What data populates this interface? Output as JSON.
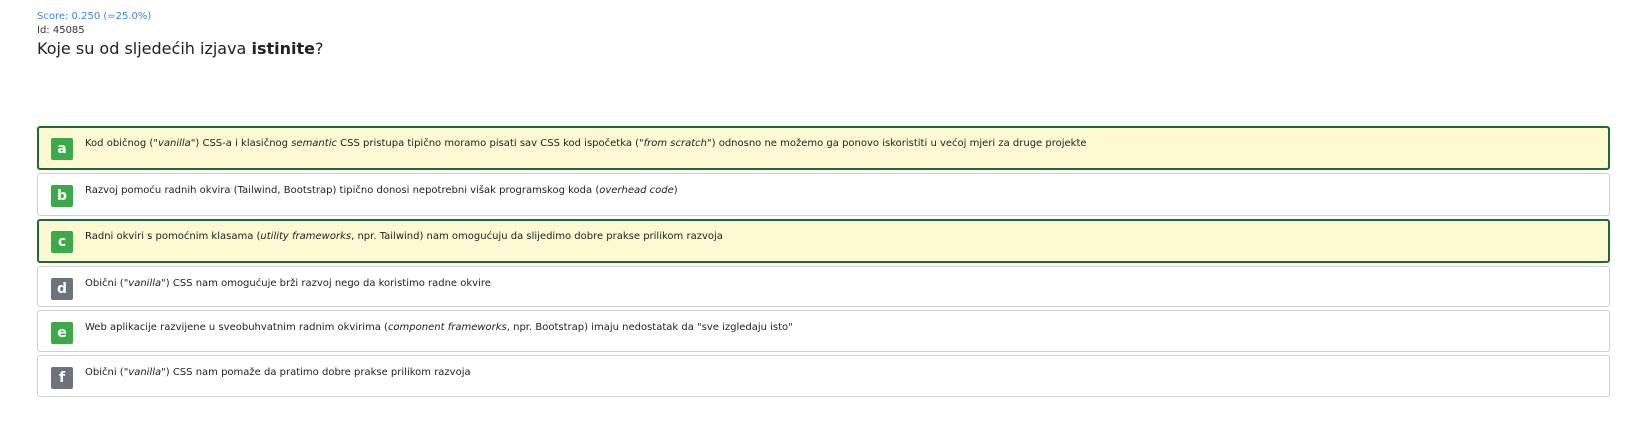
{
  "header": {
    "score": "Score: 0.250 (=25.0%)",
    "id": "Id: 45085",
    "question_pre": "Koje su od sljedećih izjava ",
    "question_bold": "istinite",
    "question_post": "?"
  },
  "options": [
    {
      "letter": "a",
      "selected": true,
      "badge_color": "green",
      "segments": [
        {
          "t": "Kod običnog (\""
        },
        {
          "t": "vanilla",
          "i": true
        },
        {
          "t": "\") CSS-a i klasičnog "
        },
        {
          "t": "semantic",
          "i": true
        },
        {
          "t": " CSS pristupa tipično moramo pisati sav CSS kod ispočetka (\""
        },
        {
          "t": "from scratch",
          "i": true
        },
        {
          "t": "\") odnosno ne možemo ga ponovo iskoristiti u većoj mjeri za druge projekte"
        }
      ]
    },
    {
      "letter": "b",
      "selected": false,
      "badge_color": "green",
      "segments": [
        {
          "t": "Razvoj pomoću radnih okvira (Tailwind, Bootstrap) tipično donosi nepotrebni višak programskog koda ("
        },
        {
          "t": "overhead code",
          "i": true
        },
        {
          "t": ")"
        }
      ]
    },
    {
      "letter": "c",
      "selected": true,
      "badge_color": "green",
      "segments": [
        {
          "t": "Radni okviri s pomoćnim klasama ("
        },
        {
          "t": "utility frameworks",
          "i": true
        },
        {
          "t": ", npr. Tailwind) nam omogućuju da slijedimo dobre prakse prilikom razvoja"
        }
      ]
    },
    {
      "letter": "d",
      "selected": false,
      "badge_color": "gray",
      "segments": [
        {
          "t": "Obični (\""
        },
        {
          "t": "vanilla",
          "i": true
        },
        {
          "t": "\") CSS nam omogućuje brži razvoj nego da koristimo radne okvire"
        }
      ]
    },
    {
      "letter": "e",
      "selected": false,
      "badge_color": "green",
      "segments": [
        {
          "t": "Web aplikacije razvijene u sveobuhvatnim radnim okvirima ("
        },
        {
          "t": "component frameworks",
          "i": true
        },
        {
          "t": ", npr. Bootstrap) imaju nedostatak da \"sve izgledaju isto\""
        }
      ]
    },
    {
      "letter": "f",
      "selected": false,
      "badge_color": "gray",
      "segments": [
        {
          "t": "Obični (\""
        },
        {
          "t": "vanilla",
          "i": true
        },
        {
          "t": "\") CSS nam pomaže da pratimo dobre prakse prilikom razvoja"
        }
      ]
    }
  ]
}
